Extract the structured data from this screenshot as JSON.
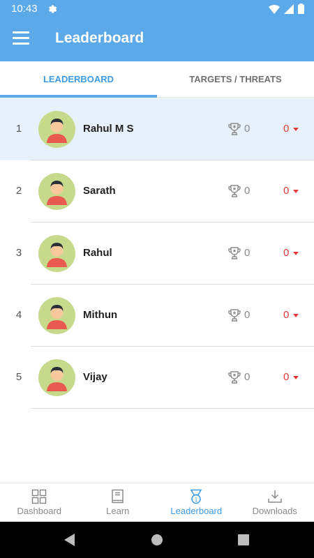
{
  "status": {
    "time": "10:43"
  },
  "app": {
    "title": "Leaderboard"
  },
  "tabs": [
    {
      "label": "LEADERBOARD",
      "active": true
    },
    {
      "label": "TARGETS / THREATS",
      "active": false
    }
  ],
  "leaderboard": [
    {
      "rank": "1",
      "name": "Rahul M S",
      "points": "0",
      "change": "0"
    },
    {
      "rank": "2",
      "name": "Sarath",
      "points": "0",
      "change": "0"
    },
    {
      "rank": "3",
      "name": "Rahul",
      "points": "0",
      "change": "0"
    },
    {
      "rank": "4",
      "name": "Mithun",
      "points": "0",
      "change": "0"
    },
    {
      "rank": "5",
      "name": "Vijay",
      "points": "0",
      "change": "0"
    }
  ],
  "bottom_nav": [
    {
      "label": "Dashboard",
      "icon": "dashboard-icon"
    },
    {
      "label": "Learn",
      "icon": "book-icon"
    },
    {
      "label": "Leaderboard",
      "icon": "medal-icon",
      "active": true
    },
    {
      "label": "Downloads",
      "icon": "download-icon"
    }
  ],
  "colors": {
    "primary": "#5ba9e8",
    "accent": "#3d9ae3",
    "negative": "#e53935",
    "avatar_bg": "#c7da8c"
  }
}
